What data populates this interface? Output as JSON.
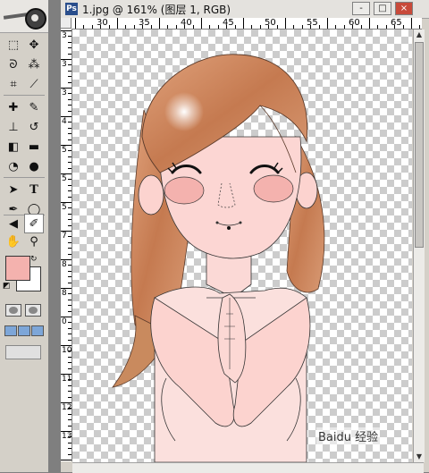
{
  "document": {
    "title": "1.jpg @ 161% (图层 1, RGB)",
    "zoom": "161%",
    "layer": "图层 1",
    "mode": "RGB"
  },
  "window_controls": {
    "minimize": "-",
    "maximize": "□",
    "close": "×"
  },
  "ruler_top_labels": [
    "30",
    "35",
    "40",
    "45",
    "50",
    "55",
    "60",
    "65"
  ],
  "ruler_left_labels": [
    "3",
    "3",
    "3",
    "4",
    "5",
    "5",
    "5",
    "7",
    "8",
    "8",
    "0",
    "10",
    "11",
    "12",
    "13"
  ],
  "colors": {
    "foreground": "#f4b2ae",
    "background": "#ffffff",
    "hair": "#c8825a",
    "skin": "#fbd6d3"
  },
  "tools": [
    {
      "id": "marquee",
      "icon": "marquee-icon",
      "glyph": "⬚"
    },
    {
      "id": "move",
      "icon": "move-icon",
      "glyph": "✥"
    },
    {
      "id": "lasso",
      "icon": "lasso-icon",
      "glyph": "ᘐ"
    },
    {
      "id": "magic-wand",
      "icon": "magic-wand-icon",
      "glyph": "⁂"
    },
    {
      "id": "crop",
      "icon": "crop-icon",
      "glyph": "⌗"
    },
    {
      "id": "slice",
      "icon": "slice-icon",
      "glyph": "⟋"
    },
    {
      "id": "healing",
      "icon": "healing-brush-icon",
      "glyph": "✚"
    },
    {
      "id": "brush",
      "icon": "brush-icon",
      "glyph": "✎"
    },
    {
      "id": "stamp",
      "icon": "clone-stamp-icon",
      "glyph": "⊥"
    },
    {
      "id": "history-brush",
      "icon": "history-brush-icon",
      "glyph": "↺"
    },
    {
      "id": "eraser",
      "icon": "eraser-icon",
      "glyph": "◧"
    },
    {
      "id": "gradient",
      "icon": "gradient-icon",
      "glyph": "▬"
    },
    {
      "id": "blur",
      "icon": "blur-icon",
      "glyph": "◔"
    },
    {
      "id": "dodge",
      "icon": "dodge-icon",
      "glyph": "●"
    },
    {
      "id": "path-select",
      "icon": "path-select-icon",
      "glyph": "➤"
    },
    {
      "id": "type",
      "icon": "type-icon",
      "glyph": "T"
    },
    {
      "id": "pen",
      "icon": "pen-icon",
      "glyph": "✒"
    },
    {
      "id": "shape",
      "icon": "ellipse-shape-icon",
      "glyph": "◯"
    },
    {
      "id": "notes",
      "icon": "audio-notes-icon",
      "glyph": "◀"
    },
    {
      "id": "eyedropper",
      "icon": "eyedropper-icon",
      "glyph": "✐"
    },
    {
      "id": "hand",
      "icon": "hand-icon",
      "glyph": "✋"
    },
    {
      "id": "zoom",
      "icon": "zoom-icon",
      "glyph": "⚲"
    }
  ],
  "watermark": "Baidu 经验"
}
